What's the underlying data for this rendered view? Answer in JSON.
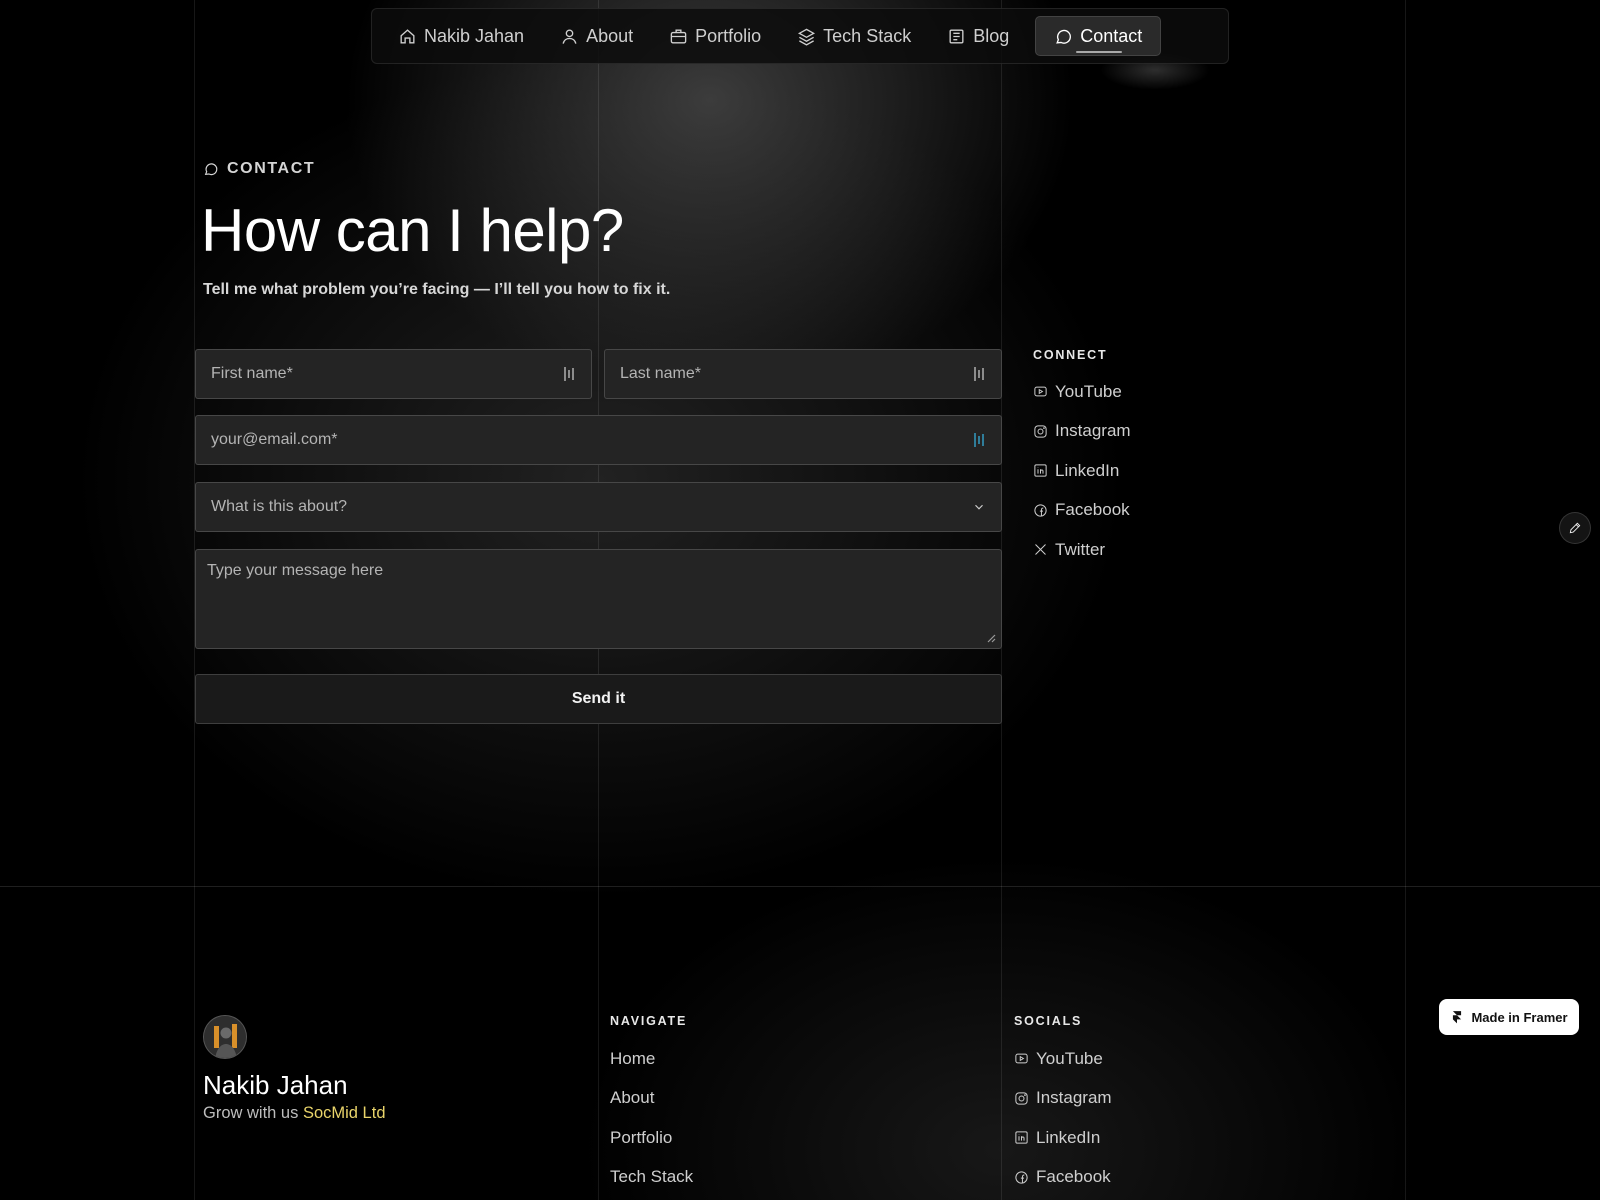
{
  "nav": {
    "items": [
      {
        "label": "Nakib Jahan",
        "icon": "home-icon"
      },
      {
        "label": "About",
        "icon": "user-icon"
      },
      {
        "label": "Portfolio",
        "icon": "briefcase-icon"
      },
      {
        "label": "Tech Stack",
        "icon": "layers-icon"
      },
      {
        "label": "Blog",
        "icon": "newspaper-icon"
      },
      {
        "label": "Contact",
        "icon": "message-circle-icon",
        "active": true
      }
    ]
  },
  "hero": {
    "eyebrow": "CONTACT",
    "title": "How can I help?",
    "subtitle": "Tell me what problem you’re facing — I’ll tell you how to fix it."
  },
  "form": {
    "first_name_placeholder": "First name*",
    "last_name_placeholder": "Last name*",
    "email_placeholder": "your@email.com*",
    "topic_placeholder": "What is this about?",
    "message_placeholder": "Type your message here",
    "submit_label": "Send it"
  },
  "connect": {
    "heading": "CONNECT",
    "links": [
      {
        "label": "YouTube",
        "icon": "youtube-icon"
      },
      {
        "label": "Instagram",
        "icon": "instagram-icon"
      },
      {
        "label": "LinkedIn",
        "icon": "linkedin-icon"
      },
      {
        "label": "Facebook",
        "icon": "facebook-icon"
      },
      {
        "label": "Twitter",
        "icon": "x-twitter-icon"
      }
    ]
  },
  "footer": {
    "name": "Nakib Jahan",
    "tagline_prefix": "Grow with us",
    "tagline_brand": "SocMid Ltd",
    "navigate": {
      "heading": "NAVIGATE",
      "links": [
        "Home",
        "About",
        "Portfolio",
        "Tech Stack"
      ]
    },
    "socials": {
      "heading": "SOCIALS",
      "links": [
        {
          "label": "YouTube",
          "icon": "youtube-icon"
        },
        {
          "label": "Instagram",
          "icon": "instagram-icon"
        },
        {
          "label": "LinkedIn",
          "icon": "linkedin-icon"
        },
        {
          "label": "Facebook",
          "icon": "facebook-icon"
        }
      ]
    }
  },
  "badge": {
    "label": "Made in Framer"
  },
  "colors": {
    "background": "#000000",
    "brand_accent": "#e9d46a",
    "field_bg": "#242424"
  }
}
